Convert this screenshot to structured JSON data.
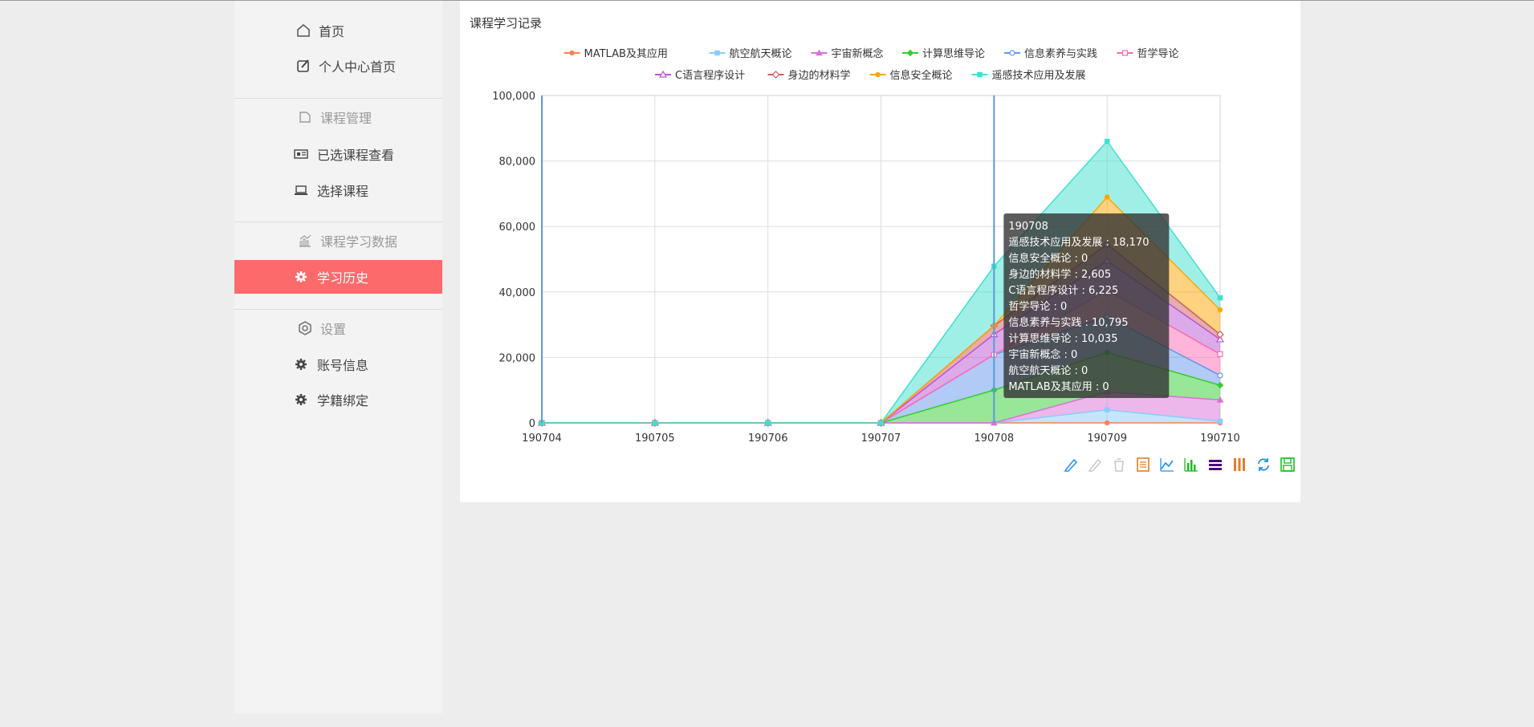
{
  "sidebar": {
    "home": "首页",
    "profile_home": "个人中心首页",
    "course_mgmt": "课程管理",
    "selected_courses": "已选课程查看",
    "choose_course": "选择课程",
    "study_data": "课程学习数据",
    "study_history": "学习历史",
    "settings": "设置",
    "account_info": "账号信息",
    "student_binding": "学籍绑定"
  },
  "panel": {
    "title": "课程学习记录"
  },
  "colors": {
    "active": "#fd6a6b",
    "axis_pointer": "#5b9bd5"
  },
  "chart_data": {
    "type": "area",
    "stacked": true,
    "x": [
      "190704",
      "190705",
      "190706",
      "190707",
      "190708",
      "190709",
      "190710"
    ],
    "ylim": [
      0,
      100000
    ],
    "yticks": [
      0,
      20000,
      40000,
      60000,
      80000,
      100000
    ],
    "ytick_labels": [
      "0",
      "20,000",
      "40,000",
      "60,000",
      "80,000",
      "100,000"
    ],
    "grid": true,
    "legend_position": "top",
    "series": [
      {
        "name": "MATLAB及其应用",
        "color": "#ff7f50",
        "marker": "circle",
        "values": [
          0,
          0,
          0,
          0,
          0,
          0,
          0
        ]
      },
      {
        "name": "航空航天概论",
        "color": "#87cefa",
        "marker": "square",
        "values": [
          0,
          0,
          0,
          0,
          0,
          4000,
          500
        ]
      },
      {
        "name": "宇宙新概念",
        "color": "#da70d6",
        "marker": "triangle",
        "values": [
          0,
          0,
          0,
          0,
          0,
          5500,
          6500
        ]
      },
      {
        "name": "计算思维导论",
        "color": "#32cd32",
        "marker": "diamond",
        "values": [
          0,
          0,
          0,
          0,
          10035,
          12000,
          4500
        ]
      },
      {
        "name": "信息素养与实践",
        "color": "#6495ed",
        "marker": "emptyCircle",
        "values": [
          0,
          0,
          0,
          0,
          10795,
          11000,
          3000
        ]
      },
      {
        "name": "哲学导论",
        "color": "#ff69b4",
        "marker": "emptyRect",
        "values": [
          0,
          0,
          0,
          0,
          0,
          8000,
          6500
        ]
      },
      {
        "name": "C语言程序设计",
        "color": "#ba55d3",
        "marker": "emptyTriangle",
        "values": [
          0,
          0,
          0,
          0,
          6225,
          9000,
          4500
        ]
      },
      {
        "name": "身边的材料学",
        "color": "#cd5c5c",
        "marker": "emptyDiamond",
        "values": [
          0,
          0,
          0,
          0,
          2605,
          5000,
          1500
        ]
      },
      {
        "name": "信息安全概论",
        "color": "#ffa500",
        "marker": "circle",
        "values": [
          0,
          0,
          0,
          0,
          0,
          14500,
          7500
        ]
      },
      {
        "name": "遥感技术应用及发展",
        "color": "#40e0d0",
        "marker": "square",
        "values": [
          0,
          0,
          0,
          0,
          18170,
          17000,
          3700
        ]
      }
    ],
    "tooltip": {
      "title": "190708",
      "lines": [
        {
          "name": "遥感技术应用及发展",
          "value": "18,170"
        },
        {
          "name": "信息安全概论",
          "value": "0"
        },
        {
          "name": "身边的材料学",
          "value": "2,605"
        },
        {
          "name": "C语言程序设计",
          "value": "6,225"
        },
        {
          "name": "哲学导论",
          "value": "0"
        },
        {
          "name": "信息素养与实践",
          "value": "10,795"
        },
        {
          "name": "计算思维导论",
          "value": "10,035"
        },
        {
          "name": "宇宙新概念",
          "value": "0"
        },
        {
          "name": "航空航天概论",
          "value": "0"
        },
        {
          "name": "MATLAB及其应用",
          "value": "0"
        }
      ]
    },
    "toolbox": [
      "mark-icon",
      "mark-undo-icon",
      "mark-clear-icon",
      "data-view-icon",
      "line-icon",
      "bar-icon",
      "stack-icon",
      "tiled-icon",
      "restore-icon",
      "save-image-icon"
    ]
  }
}
